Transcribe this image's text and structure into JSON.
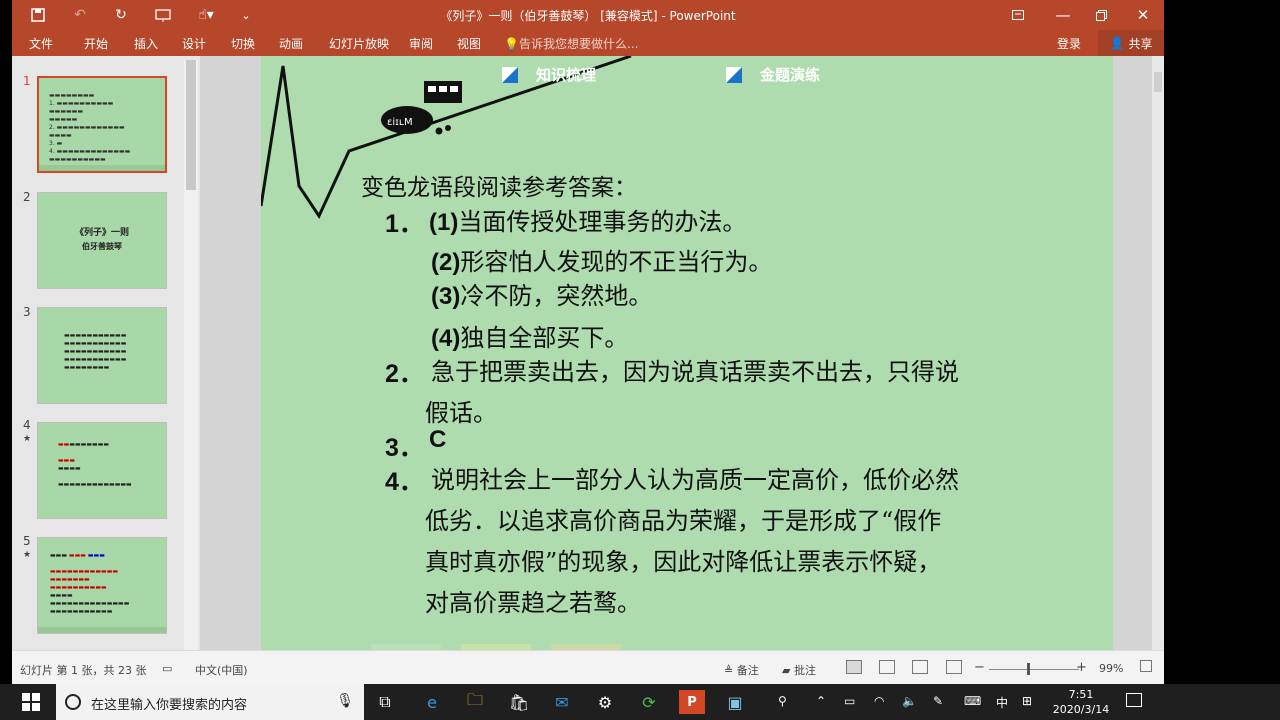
{
  "window": {
    "title": "《列子》一则（伯牙善鼓琴） [兼容模式] - PowerPoint",
    "controls": [
      "restore-ribbon",
      "minimize",
      "maximize",
      "close"
    ]
  },
  "quick_access": [
    {
      "name": "save-icon",
      "glyph": "🖫"
    },
    {
      "name": "undo-icon",
      "glyph": "↶"
    },
    {
      "name": "redo-icon",
      "glyph": "↻"
    },
    {
      "name": "present-icon",
      "glyph": "⛶"
    },
    {
      "name": "touch-icon",
      "glyph": "☝"
    },
    {
      "name": "customize-icon",
      "glyph": "⌄"
    }
  ],
  "ribbon": {
    "tabs": [
      "文件",
      "开始",
      "插入",
      "设计",
      "切换",
      "动画",
      "幻灯片放映",
      "审阅",
      "视图"
    ],
    "tell_me": "告诉我您想要做什么...",
    "login": "登录",
    "share": "共享"
  },
  "thumbnails": [
    {
      "number": "1",
      "selected": true,
      "starred": false
    },
    {
      "number": "2",
      "selected": false,
      "starred": false,
      "title": "《列子》一则",
      "subtitle": "伯牙善鼓琴"
    },
    {
      "number": "3",
      "selected": false,
      "starred": false
    },
    {
      "number": "4",
      "selected": false,
      "starred": true
    },
    {
      "number": "5",
      "selected": false,
      "starred": true
    }
  ],
  "slide": {
    "nav_left": "知识梳理",
    "nav_right": "金题演练",
    "heading": "变色龙语段阅读参考答案：",
    "answers": [
      {
        "num": "1．",
        "sub": "(1)",
        "text": "当面传授处理事务的办法。"
      },
      {
        "num": "",
        "sub": "(2)",
        "text": "形容怕人发现的不正当行为。"
      },
      {
        "num": "",
        "sub": "(3)",
        "text": "冷不防，突然地。"
      },
      {
        "num": "",
        "sub": "(4)",
        "text": "独自全部买下。"
      },
      {
        "num": "2．",
        "sub": "",
        "text": "急于把票卖出去，因为说真话票卖不出去，只得说"
      },
      {
        "num": "",
        "sub": "",
        "text": "假话。"
      },
      {
        "num": "3．",
        "sub": "",
        "text": "C"
      },
      {
        "num": "4．",
        "sub": "",
        "text": "说明社会上一部分人认为高质一定高价，低价必然"
      },
      {
        "num": "",
        "sub": "",
        "text": "低劣．以追求高价商品为荣耀，于是形成了“假作"
      },
      {
        "num": "",
        "sub": "",
        "text": "真时真亦假”的现象，因此对降低让票表示怀疑，"
      },
      {
        "num": "",
        "sub": "",
        "text": "对高价票趋之若鹜。"
      }
    ]
  },
  "status": {
    "slide_info": "幻灯片 第 1 张，共 23 张",
    "language": "中文(中国)",
    "notes": "备注",
    "comments": "批注",
    "zoom": "99%"
  },
  "taskbar": {
    "search_placeholder": "在这里输入你要搜索的内容",
    "ime_lang": "中",
    "time": "7:51",
    "date": "2020/3/14"
  },
  "colors": {
    "accent": "#b7472a",
    "slide_bg": "#aedcae",
    "selected_thumb": "#d24726"
  }
}
